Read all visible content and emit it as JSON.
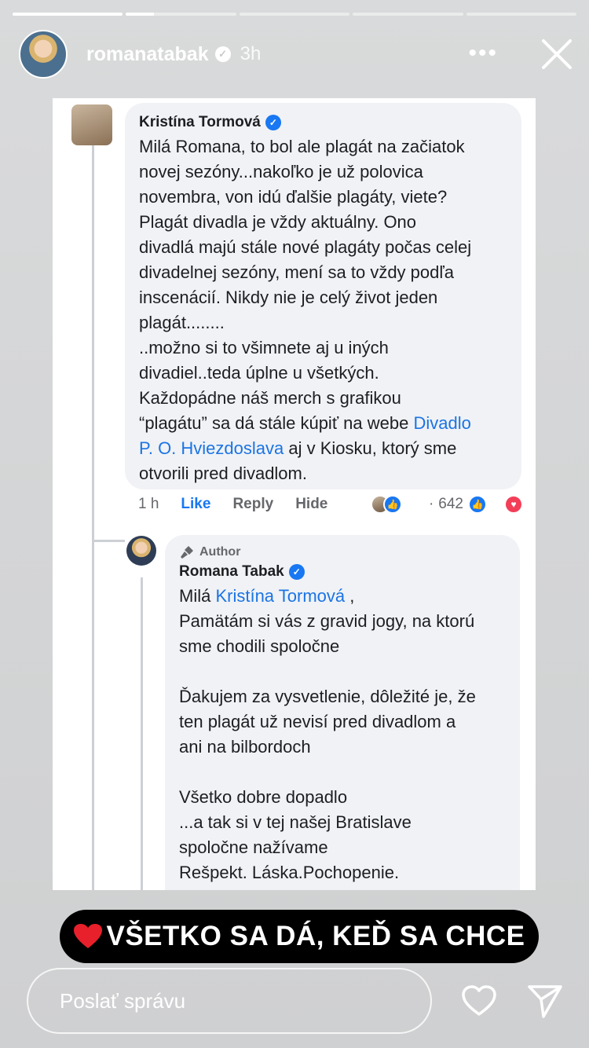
{
  "progress": [
    1.0,
    0.25,
    0,
    0,
    0
  ],
  "header": {
    "username": "romanatabak",
    "verified_glyph": "✓",
    "time": "3h",
    "more": "•••"
  },
  "comment": {
    "author": "Kristína Tormová",
    "text_before_link": "Milá Romana, to bol ale plagát na začiatok\nnovej sezóny...nakoľko je už polovica\nnovembra, von idú ďalšie plagáty, viete?\nPlagát divadla je vždy aktuálny. Ono\ndivadlá majú stále nové plagáty počas celej\ndivadelnej sezóny, mení sa to vždy podľa\ninscenácií. Nikdy nie je celý život jeden\nplagát........\n..možno si to všimnete aj u iných\ndivadiel..teda úplne u všetkých.\nKaždopádne náš merch s grafikou\n“plagátu” sa dá stále kúpiť na webe ",
    "link": "Divadlo\nP. O. Hviezdoslava",
    "text_after_link": " aj v Kiosku, ktorý sme\notvorili pred divadlom.",
    "time": "1 h",
    "like": "Like",
    "reply": "Reply",
    "hide": "Hide",
    "reaction_count": "642"
  },
  "reply": {
    "author_tag": "Author",
    "author": "Romana Tabak",
    "greeting": "Milá ",
    "mention": "Kristína Tormová",
    "greeting_end": " ,",
    "text": "Pamätám si vás z gravid jogy, na ktorú\nsme chodili spoločne\n\nĎakujem za vysvetlenie, dôležité je, že\nten plagát už nevisí pred divadlom a\nani na bilbordoch\n\nVšetko dobre dopadlo\n...a tak si v tej našej Bratislave\nspoločne nažívame\nRešpekt. Láska.Pochopenie."
  },
  "caption": {
    "text": "VŠETKO SA DÁ, KEĎ SA CHCE"
  },
  "bottom": {
    "placeholder": "Poslať správu"
  },
  "colors": {
    "link": "#1b74e4",
    "verified": "#1877f2",
    "love": "#f33e58"
  }
}
